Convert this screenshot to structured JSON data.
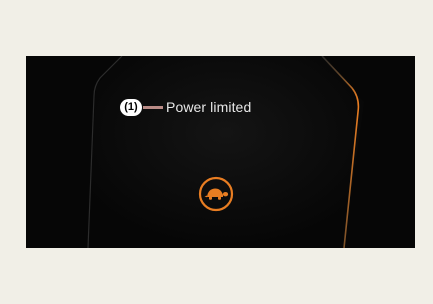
{
  "callout": {
    "number": "(1)",
    "text": "Power limited"
  },
  "icons": {
    "warning": "turtle-icon"
  },
  "colors": {
    "page_background": "#f1efe7",
    "screen_background": "#060606",
    "accent": "#e87d22",
    "callout_line": "#b98b86",
    "text": "#e8e8e8"
  }
}
